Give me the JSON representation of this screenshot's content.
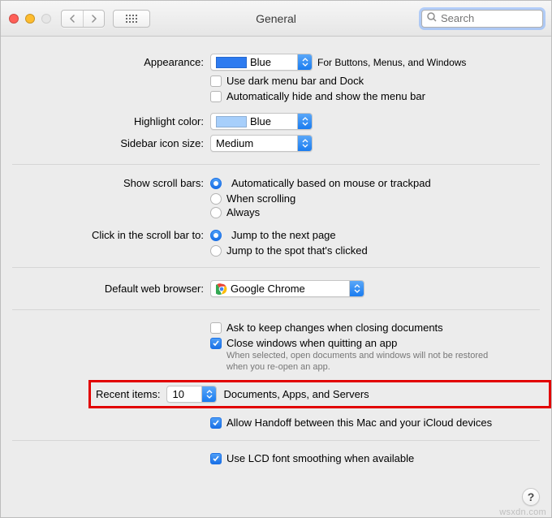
{
  "toolbar": {
    "title": "General",
    "search_placeholder": "Search"
  },
  "appearance": {
    "label": "Appearance:",
    "value": "Blue",
    "hint": "For Buttons, Menus, and Windows",
    "dark_menu": "Use dark menu bar and Dock",
    "auto_hide": "Automatically hide and show the menu bar"
  },
  "highlight": {
    "label": "Highlight color:",
    "value": "Blue"
  },
  "sidebar": {
    "label": "Sidebar icon size:",
    "value": "Medium"
  },
  "scrollbars": {
    "label": "Show scroll bars:",
    "auto": "Automatically based on mouse or trackpad",
    "scrolling": "When scrolling",
    "always": "Always"
  },
  "clickbar": {
    "label": "Click in the scroll bar to:",
    "next": "Jump to the next page",
    "spot": "Jump to the spot that's clicked"
  },
  "browser": {
    "label": "Default web browser:",
    "value": "Google Chrome"
  },
  "closing": {
    "ask": "Ask to keep changes when closing documents",
    "close": "Close windows when quitting an app",
    "hint1": "When selected, open documents and windows will not be restored",
    "hint2": "when you re-open an app."
  },
  "recent": {
    "label": "Recent items:",
    "value": "10",
    "suffix": "Documents, Apps, and Servers"
  },
  "handoff": {
    "label": "Allow Handoff between this Mac and your iCloud devices"
  },
  "lcd": {
    "label": "Use LCD font smoothing when available"
  },
  "help": "?",
  "watermark": "wsxdn.com"
}
